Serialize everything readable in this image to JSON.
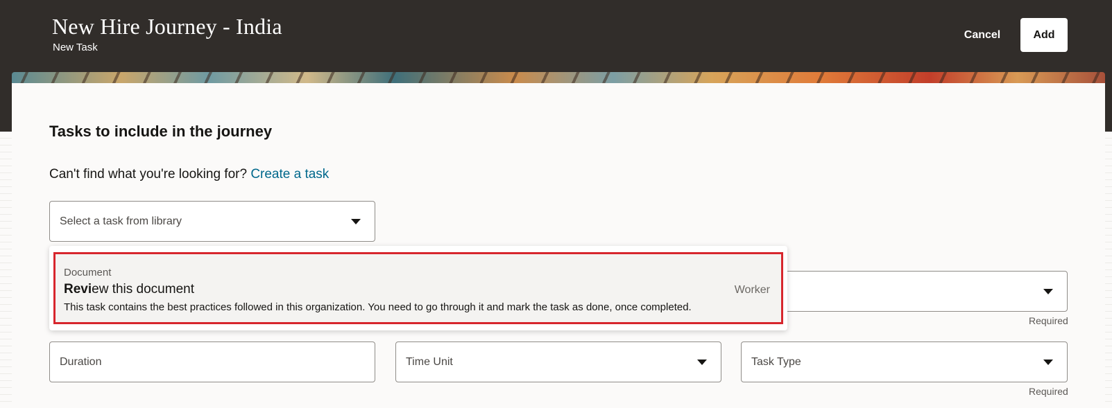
{
  "header": {
    "title": "New Hire Journey - India",
    "subtitle": "New Task",
    "cancel_label": "Cancel",
    "add_label": "Add"
  },
  "section": {
    "title": "Tasks to include in the journey",
    "help_text": "Can't find what you're looking for?",
    "create_link": "Create a task"
  },
  "library_select": {
    "placeholder": "Select a task from library"
  },
  "dropdown_option": {
    "category": "Document",
    "title_match": "Revi",
    "title_rest": "ew this document",
    "description": "This task contains the best practices followed in this organization. You need to go through it and mark the task as done, once completed.",
    "role": "Worker"
  },
  "fields": {
    "duration": "Duration",
    "time_unit": "Time Unit",
    "task_type": "Task Type",
    "required_label": "Required"
  },
  "colors": {
    "header_bg": "#312d2a",
    "link": "#00688c",
    "highlight_border": "#d7262d"
  },
  "icons": [
    "chevron-down-icon"
  ]
}
